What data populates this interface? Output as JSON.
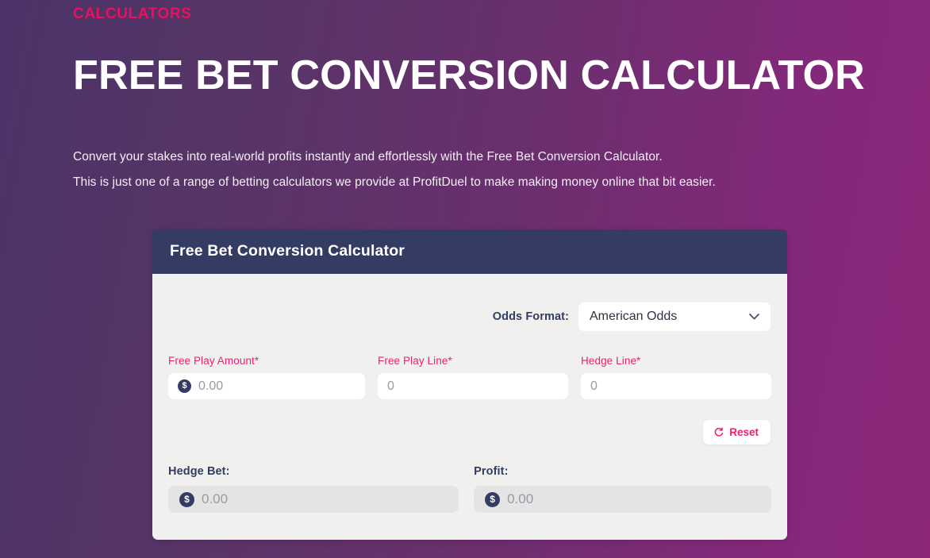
{
  "hero": {
    "eyebrow": "CALCULATORS",
    "title": "FREE BET CONVERSION CALCULATOR",
    "paragraph_1": "Convert your stakes into real-world profits instantly and effortlessly with the Free Bet Conversion Calculator.",
    "paragraph_2": "This is just one of a range of betting calculators we provide at ProfitDuel to make making money online that bit easier."
  },
  "calculator": {
    "header_title": "Free Bet Conversion Calculator",
    "odds_format": {
      "label": "Odds Format:",
      "selected": "American Odds",
      "options": [
        "American Odds"
      ]
    },
    "inputs": [
      {
        "label": "Free Play Amount*",
        "value": "",
        "placeholder": "0.00",
        "currency_symbol": "$",
        "has_currency_badge": true
      },
      {
        "label": "Free Play Line*",
        "value": "",
        "placeholder": "0",
        "has_currency_badge": false
      },
      {
        "label": "Hedge Line*",
        "value": "",
        "placeholder": "0",
        "has_currency_badge": false
      }
    ],
    "reset": {
      "label": "Reset",
      "icon": "refresh-icon"
    },
    "results": [
      {
        "label": "Hedge Bet:",
        "value": "0.00",
        "currency_symbol": "$"
      },
      {
        "label": "Profit:",
        "value": "0.00",
        "currency_symbol": "$"
      }
    ]
  },
  "colors": {
    "accent_pink": "#ec0f5e",
    "label_pink": "#ec1f72",
    "navy": "#343c63",
    "card_body": "#f0f0ef",
    "bg_purple_left": "#4b3369",
    "bg_magenta_right": "#8d2879"
  }
}
